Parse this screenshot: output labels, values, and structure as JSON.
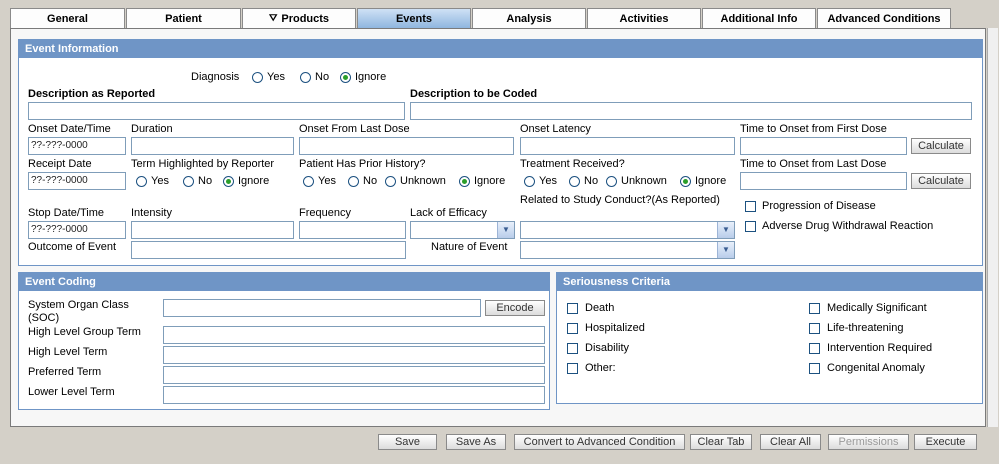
{
  "tabs": [
    {
      "label": "General"
    },
    {
      "label": "Patient"
    },
    {
      "label": "Products"
    },
    {
      "label": "Events"
    },
    {
      "label": "Analysis"
    },
    {
      "label": "Activities"
    },
    {
      "label": "Additional Info"
    },
    {
      "label": "Advanced Conditions"
    }
  ],
  "event_info": {
    "title": "Event Information",
    "diagnosis_label": "Diagnosis",
    "diagnosis_selected": "Ignore",
    "desc_reported": "Description as Reported",
    "desc_coded": "Description to be Coded",
    "onset_date": "Onset Date/Time",
    "duration": "Duration",
    "onset_last_dose": "Onset From Last Dose",
    "onset_latency": "Onset Latency",
    "time_first_dose": "Time to Onset from First Dose",
    "receipt_date": "Receipt Date",
    "term_highlighted": "Term Highlighted by Reporter",
    "prior_history": "Patient Has Prior History?",
    "treatment_received": "Treatment Received?",
    "time_last_dose": "Time to Onset from Last Dose",
    "stop_date": "Stop Date/Time",
    "intensity": "Intensity",
    "frequency": "Frequency",
    "lack_efficacy": "Lack of Efficacy",
    "related_study": "Related to Study Conduct?(As Reported)",
    "outcome": "Outcome of Event",
    "nature": "Nature of Event",
    "progression": "Progression of Disease",
    "adverse_withdrawal": "Adverse Drug Withdrawal Reaction",
    "date_value": "??-???-0000",
    "calculate": "Calculate"
  },
  "radio": {
    "yes": "Yes",
    "no": "No",
    "ignore": "Ignore",
    "unknown": "Unknown"
  },
  "coding": {
    "title": "Event Coding",
    "soc": "System Organ Class (SOC)",
    "hlgt": "High Level Group Term",
    "hlt": "High Level Term",
    "pt": "Preferred Term",
    "llt": "Lower Level Term",
    "encode": "Encode"
  },
  "seriousness": {
    "title": "Seriousness Criteria",
    "left": [
      "Death",
      "Hospitalized",
      "Disability",
      "Other:"
    ],
    "right": [
      "Medically Significant",
      "Life-threatening",
      "Intervention Required",
      "Congenital Anomaly"
    ]
  },
  "buttons": {
    "save": "Save",
    "save_as": "Save As",
    "convert": "Convert to Advanced Condition",
    "clear_tab": "Clear Tab",
    "clear_all": "Clear All",
    "permissions": "Permissions",
    "execute": "Execute"
  },
  "colors": {
    "header": "#6f95c6",
    "active_tab": "#8fb6df",
    "radio_on": "#2a9e2a"
  }
}
